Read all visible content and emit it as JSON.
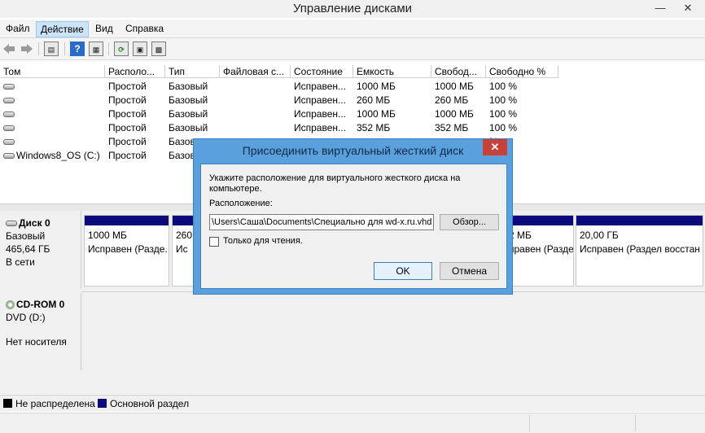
{
  "window": {
    "title": "Управление дисками",
    "minimize_glyph": "—",
    "close_glyph": "✕"
  },
  "menu": [
    {
      "label": "Файл"
    },
    {
      "label": "Действие"
    },
    {
      "label": "Вид"
    },
    {
      "label": "Справка"
    }
  ],
  "toolbar": {
    "back_icon": "arrow-left-icon",
    "forward_icon": "arrow-right-icon",
    "help_glyph": "?",
    "refresh_glyph": "⟳"
  },
  "table": {
    "columns": [
      "Том",
      "Располо...",
      "Тип",
      "Файловая с...",
      "Состояние",
      "Емкость",
      "Свобод...",
      "Свободно %"
    ],
    "rows": [
      {
        "tom": "",
        "layout": "Простой",
        "type": "Базовый",
        "fs": "",
        "state": "Исправен...",
        "cap": "1000 МБ",
        "free": "1000 МБ",
        "pct": "100 %"
      },
      {
        "tom": "",
        "layout": "Простой",
        "type": "Базовый",
        "fs": "",
        "state": "Исправен...",
        "cap": "260 МБ",
        "free": "260 МБ",
        "pct": "100 %"
      },
      {
        "tom": "",
        "layout": "Простой",
        "type": "Базовый",
        "fs": "",
        "state": "Исправен...",
        "cap": "1000 МБ",
        "free": "1000 МБ",
        "pct": "100 %"
      },
      {
        "tom": "",
        "layout": "Простой",
        "type": "Базовый",
        "fs": "",
        "state": "Исправен...",
        "cap": "352 МБ",
        "free": "352 МБ",
        "pct": "100 %"
      },
      {
        "tom": "",
        "layout": "Простой",
        "type": "Базов",
        "fs": "",
        "state": "",
        "cap": "",
        "free": "",
        "pct": "%"
      },
      {
        "tom": "Windows8_OS (C:)",
        "layout": "Простой",
        "type": "Базов",
        "fs": "",
        "state": "",
        "cap": "",
        "free": "",
        "pct": "%"
      }
    ]
  },
  "disks": [
    {
      "name": "Диск 0",
      "kind": "Базовый",
      "size": "465,64 ГБ",
      "status": "В сети"
    },
    {
      "name": "CD-ROM 0",
      "kind": "DVD (D:)",
      "size": "",
      "status": "Нет носителя"
    }
  ],
  "partitions": [
    {
      "size": "1000 МБ",
      "status": "Исправен (Разде."
    },
    {
      "size": "260",
      "status": "Ис"
    },
    {
      "size": "2 МБ",
      "status": "правен (Разде"
    },
    {
      "size": "20,00 ГБ",
      "status": "Исправен (Раздел восстан"
    }
  ],
  "legend": [
    {
      "label": "Не распределена",
      "color": "#000000"
    },
    {
      "label": "Основной раздел",
      "color": "#0a0a7a"
    }
  ],
  "dialog": {
    "title": "Присоединить виртуальный жесткий диск",
    "description": "Укажите расположение для виртуального жесткого диска на компьютере.",
    "location_label": "Расположение:",
    "path_value": "\\Users\\Саша\\Documents\\Специально для wd-x.ru.vhd",
    "browse_label": "Обзор...",
    "readonly_label": "Только для чтения.",
    "readonly_checked": false,
    "ok_label": "OK",
    "cancel_label": "Отмена"
  }
}
